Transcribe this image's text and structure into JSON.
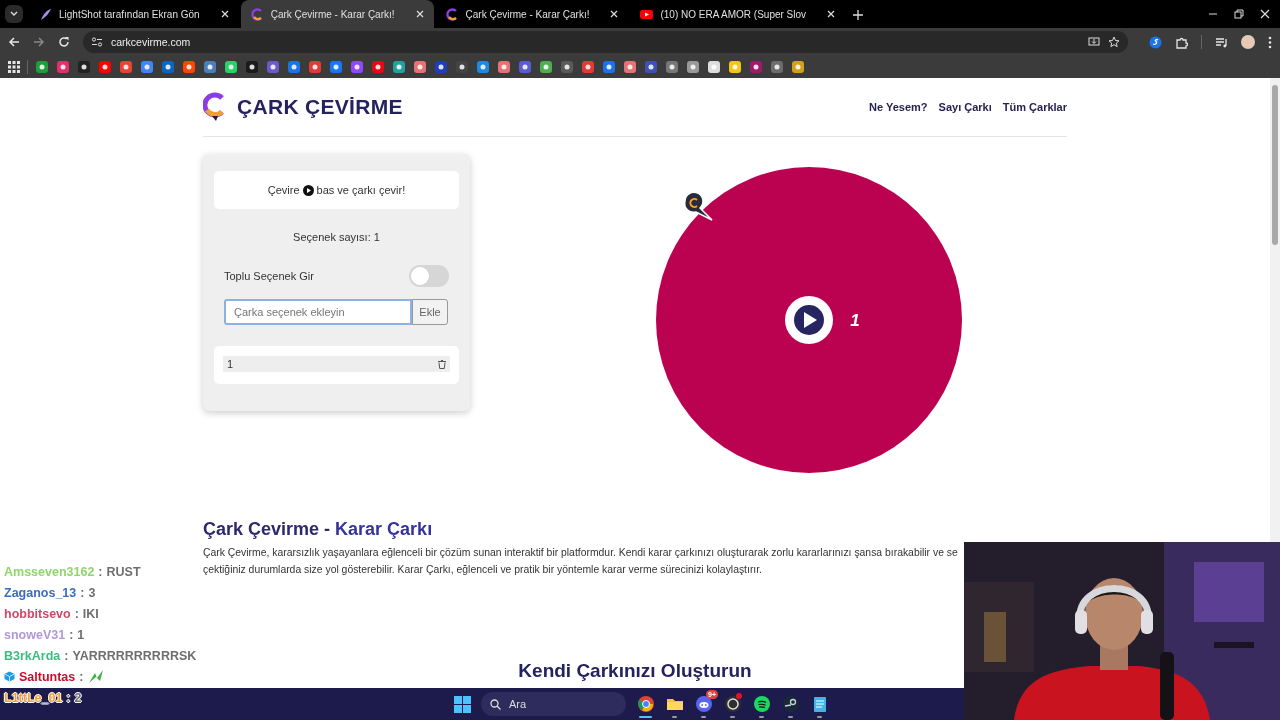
{
  "window": {
    "tabs": [
      {
        "title": "LightShot tarafından Ekran Gön",
        "kind": "lightshot",
        "selected": false
      },
      {
        "title": "Çark Çevirme - Karar Çarkı!",
        "kind": "wheel",
        "selected": true
      },
      {
        "title": "Çark Çevirme - Karar Çarkı!",
        "kind": "wheel",
        "selected": false
      },
      {
        "title": "(10) NO ERA AMOR (Super Slov",
        "kind": "video",
        "selected": false
      }
    ],
    "address": "carkcevirme.com"
  },
  "page": {
    "logo_title": "ÇARK ÇEVİRME",
    "nav": [
      "Ne Yesem?",
      "Sayı Çarkı",
      "Tüm Çarklar"
    ],
    "panel": {
      "instruction_before": "Çevire",
      "instruction_after": "bas ve çarkı çevir!",
      "option_count": "Seçenek sayısı: 1",
      "bulk_toggle": {
        "label": "Toplu Seçenek Gir",
        "on": false
      },
      "input": {
        "placeholder": "Çarka seçenek ekleyin",
        "focused": true
      },
      "add_button": "Ekle",
      "options": [
        "1"
      ]
    },
    "wheel": {
      "segments": [
        {
          "label": "1",
          "color": "#bb0250"
        }
      ]
    },
    "article": {
      "title_main": "Çark Çevirme -",
      "title_accent": "Karar Çarkı",
      "lines": [
        "Çark Çevirme, kararsızlık yaşayanlara eğlenceli bir çözüm sunan interaktif bir platformdur. Kendi karar çarkınızı oluşturarak zorlu kararlarınızı şansa bırakabilir ve se",
        "çektiğiniz durumlarda size yol gösterebilir. Karar Çarkı, eğlenceli ve pratik bir yöntemle karar verme sürecinizi kolaylaştırır."
      ]
    },
    "next_heading": "Kendi Çarkınızı Oluşturun"
  },
  "chat": [
    {
      "user": "Amsseven3162",
      "separator": ":",
      "message": "RUST",
      "kind": "text",
      "badge": false,
      "color": "#8fd66a"
    },
    {
      "user": "Zaganos_13",
      "separator": ":",
      "message": "3",
      "kind": "text",
      "badge": false,
      "color": "#3a6cc0"
    },
    {
      "user": "hobbitsevo",
      "separator": ":",
      "message": "IKI",
      "kind": "text",
      "badge": false,
      "color": "#cc4a66"
    },
    {
      "user": "snoweV31",
      "separator": ":",
      "message": "1",
      "kind": "text",
      "badge": false,
      "color": "#b197d9"
    },
    {
      "user": "B3rkArda",
      "separator": ":",
      "message": "YARRRRRRRRRRSK",
      "kind": "text",
      "badge": false,
      "color": "#3dbb80"
    },
    {
      "user": "Saltuntas",
      "separator": ":",
      "kind": "emote",
      "badge": true,
      "color": "#c8102e"
    },
    {
      "user": "L1ttLe_01",
      "separator": ":",
      "message": "2",
      "kind": "text",
      "badge": false,
      "color": "#f0a030"
    }
  ],
  "taskbar": {
    "search_placeholder": "Ara",
    "apps": [
      {
        "kind": "browser",
        "active": true,
        "alert": false
      },
      {
        "kind": "folder",
        "active": false,
        "alert": false
      },
      {
        "kind": "discord",
        "active": false,
        "alert": false,
        "badge": "9+"
      },
      {
        "kind": "recorder",
        "active": false,
        "alert": true
      },
      {
        "kind": "music",
        "active": false,
        "alert": false
      },
      {
        "kind": "steam",
        "active": false,
        "alert": false
      },
      {
        "kind": "notepad",
        "active": false,
        "alert": false
      }
    ]
  }
}
